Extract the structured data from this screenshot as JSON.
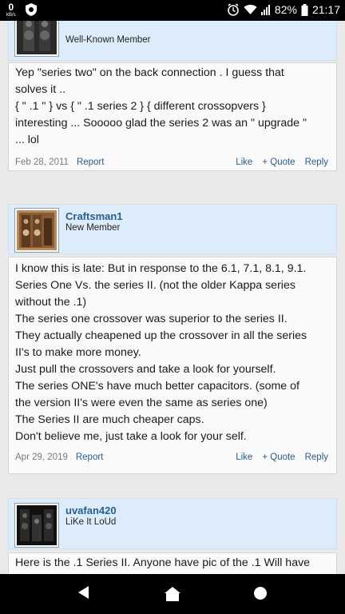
{
  "status_bar": {
    "speed_value": "0",
    "speed_unit": "kB/s",
    "battery": "82%",
    "time": "21:17",
    "icons": [
      "security-shield-icon",
      "moon-icon",
      "alarm-icon",
      "wifi-icon",
      "signal-icon",
      "battery-icon"
    ]
  },
  "posts": [
    {
      "username": "",
      "user_title": "Well-Known Member",
      "lines": [
        "Yep \"series two\" on the back connection . I guess that",
        "solves it ..",
        "{ \" .1 \" } vs { \" .1 series 2 } { different crossopvers }",
        "interesting ... Sooooo glad the series 2 was an \" upgrade \"",
        "... lol"
      ],
      "date": "Feb 28, 2011",
      "report": "Report",
      "like": "Like",
      "quote": "+ Quote",
      "reply": "Reply"
    },
    {
      "username": "Craftsman1",
      "user_title": "New Member",
      "lines": [
        "I know this is late: But in response to the 6.1, 7.1, 8.1, 9.1.",
        "Series One Vs. the series II. (not the older Kappa series",
        "without the .1)",
        "The series one crossover was superior to the series II.",
        "They actually cheapened up the crossover in all the series",
        "II's to make more money.",
        "Just pull the crossovers and take a look for yourself.",
        "The series ONE's have much better capacitors. (some of",
        "the version II's were even the same as series one)",
        "The Series II are much cheaper caps.",
        "Don't believe me, just take a look for your self."
      ],
      "date": "Apr 29, 2019",
      "report": "Report",
      "like": "Like",
      "quote": "+ Quote",
      "reply": "Reply"
    },
    {
      "username": "uvafan420",
      "user_title": "LiKe It LoUd",
      "lines": [
        "Here is the .1 Series II. Anyone have pic of the .1 Will have"
      ]
    }
  ],
  "colors": {
    "header_bg": "#dcecfa",
    "link": "#2b5d8a",
    "page_bg": "#e9e9e9"
  }
}
